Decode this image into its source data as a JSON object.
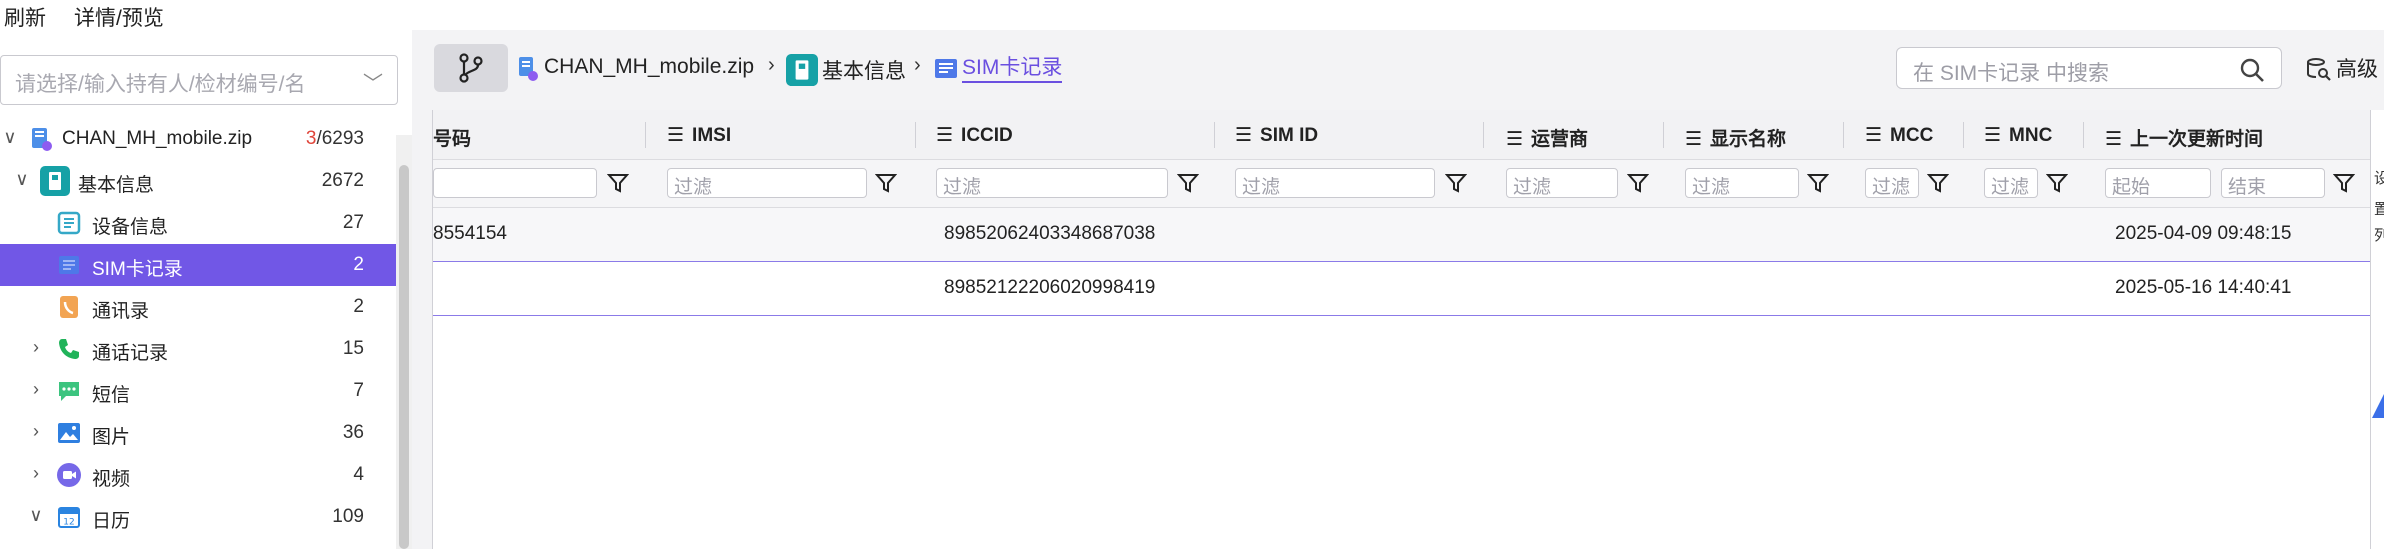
{
  "menu": {
    "refresh": "刷新",
    "details": "详情/预览"
  },
  "sidebar": {
    "search_placeholder": "请选择/输入持有人/检材编号/名",
    "root": {
      "label": "CHAN_MH_mobile.zip",
      "count_highlight": "3",
      "count_rest": "/6293"
    },
    "items": [
      {
        "label": "基本信息",
        "count": "2672",
        "icon": "info-card-icon",
        "color": "#16a1a6"
      },
      {
        "label": "设备信息",
        "count": "27",
        "icon": "device-info-icon",
        "color": "#35a8c7"
      },
      {
        "label": "SIM卡记录",
        "count": "2",
        "icon": "sim-card-icon",
        "color": "#6655e0"
      },
      {
        "label": "通讯录",
        "count": "2",
        "icon": "contacts-icon",
        "color": "#f2a453"
      },
      {
        "label": "通话记录",
        "count": "15",
        "icon": "phone-icon",
        "color": "#21b35a"
      },
      {
        "label": "短信",
        "count": "7",
        "icon": "sms-icon",
        "color": "#3cc47f"
      },
      {
        "label": "图片",
        "count": "36",
        "icon": "image-icon",
        "color": "#2f7fe0"
      },
      {
        "label": "视频",
        "count": "4",
        "icon": "video-icon",
        "color": "#7668e8"
      },
      {
        "label": "日历",
        "count": "109",
        "icon": "calendar-icon",
        "color": "#2a84e0"
      }
    ]
  },
  "breadcrumb": {
    "file": "CHAN_MH_mobile.zip",
    "category": "基本信息",
    "current": "SIM卡记录"
  },
  "search": {
    "placeholder": "在 SIM卡记录 中搜索"
  },
  "advanced_label": "高级",
  "table": {
    "columns": [
      "号码",
      "IMSI",
      "ICCID",
      "SIM ID",
      "运营商",
      "显示名称",
      "MCC",
      "MNC",
      "上一次更新时间"
    ],
    "filter_placeholder": "过滤",
    "filter_start": "起始",
    "filter_end": "结束",
    "rows": [
      {
        "number": "8554154",
        "iccid": "89852062403348687038",
        "updated": "2025-04-09 09:48:15"
      },
      {
        "number": "",
        "iccid": "89852122206020998419",
        "updated": "2025-05-16 14:40:41"
      }
    ]
  },
  "edge_glyphs": [
    "设",
    "置",
    "列"
  ]
}
